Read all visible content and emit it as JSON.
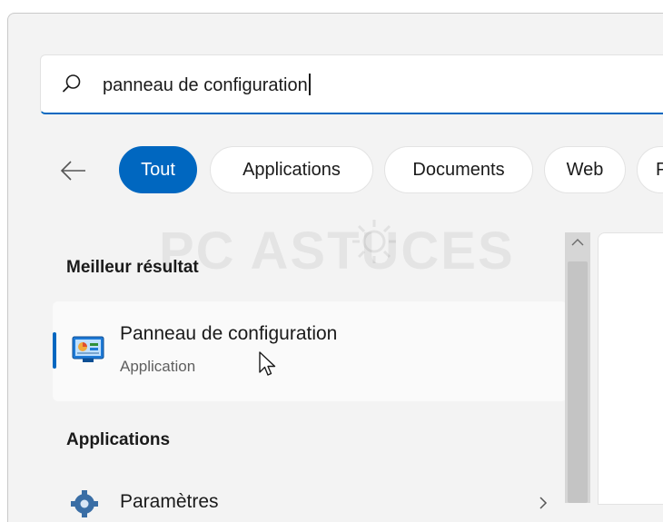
{
  "search": {
    "query": "panneau de configuration"
  },
  "filters": [
    {
      "label": "Tout",
      "active": true
    },
    {
      "label": "Applications",
      "active": false
    },
    {
      "label": "Documents",
      "active": false
    },
    {
      "label": "Web",
      "active": false
    },
    {
      "label": "P",
      "active": false
    }
  ],
  "watermark": {
    "text": "PC ASTUCES"
  },
  "best_match": {
    "section_title": "Meilleur résultat",
    "name": "Panneau de configuration",
    "type": "Application"
  },
  "apps": {
    "section_title": "Applications",
    "items": [
      {
        "name": "Paramètres"
      }
    ]
  },
  "colors": {
    "accent": "#0067c0",
    "panel_bg": "#f3f3f3"
  },
  "icons": [
    "search-icon",
    "back-arrow-icon",
    "control-panel-icon",
    "mouse-cursor-icon",
    "gear-icon",
    "chevron-right-icon",
    "scroll-up-icon"
  ]
}
